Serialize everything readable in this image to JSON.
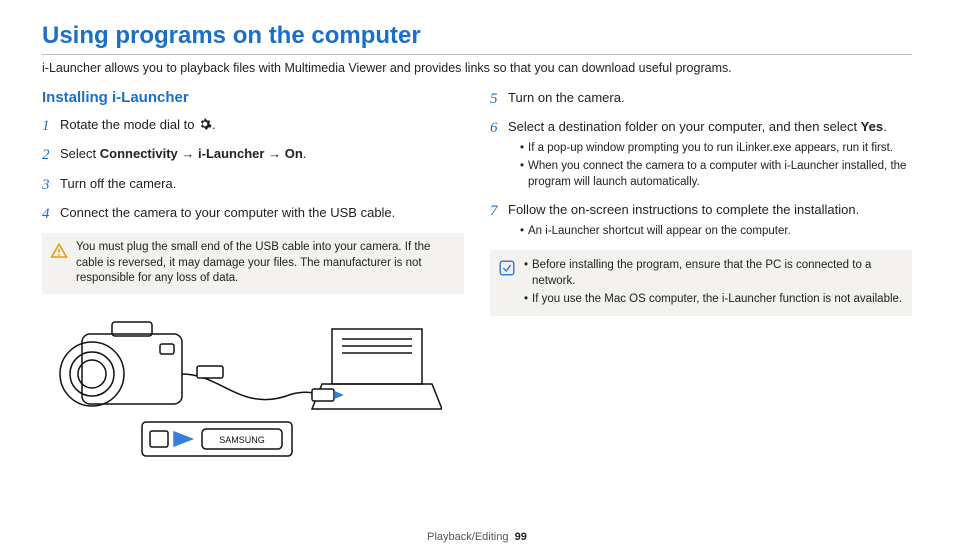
{
  "title": "Using programs on the computer",
  "intro": "i-Launcher allows you to playback files with Multimedia Viewer and provides links so that you can download useful programs.",
  "left": {
    "subhead": "Installing i-Launcher",
    "step1_pre": "Rotate the mode dial to ",
    "step1_post": ".",
    "step2_a": "Select ",
    "step2_b": "Connectivity",
    "step2_arrow1": " → ",
    "step2_c": "i-Launcher",
    "step2_arrow2": " → ",
    "step2_d": "On",
    "step2_e": ".",
    "step3": "Turn off the camera.",
    "step4": "Connect the camera to your computer with the USB cable.",
    "warn": "You must plug the small end of the USB cable into your camera. If the cable is reversed, it may damage your files. The manufacturer is not responsible for any loss of data."
  },
  "right": {
    "step5": "Turn on the camera.",
    "step6_a": "Select a destination folder on your computer, and then select ",
    "step6_b": "Yes",
    "step6_c": ".",
    "step6_sub1": "If a pop-up window prompting you to run iLinker.exe appears, run it first.",
    "step6_sub2": "When you connect the camera to a computer with i-Launcher installed, the program will launch automatically.",
    "step7": "Follow the on-screen instructions to complete the installation.",
    "step7_sub1": "An i-Launcher shortcut will appear on the computer.",
    "note1": "Before installing the program, ensure that the PC is connected to a network.",
    "note2": "If you use the Mac OS computer, the i-Launcher function is not available."
  },
  "nums": {
    "n1": "1",
    "n2": "2",
    "n3": "3",
    "n4": "4",
    "n5": "5",
    "n6": "6",
    "n7": "7"
  },
  "footer": {
    "section": "Playback/Editing",
    "page": "99"
  }
}
